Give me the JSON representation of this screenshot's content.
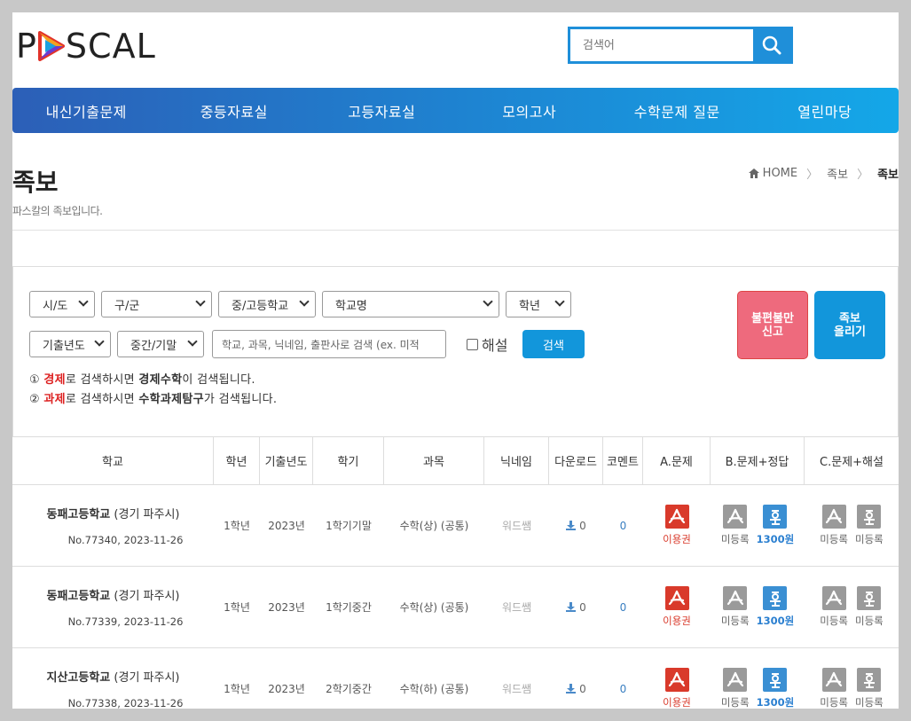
{
  "header": {
    "logo_left": "P",
    "logo_right": "SCAL",
    "search_placeholder": "검색어"
  },
  "nav": [
    "내신기출문제",
    "중등자료실",
    "고등자료실",
    "모의고사",
    "수학문제 질문",
    "열린마당"
  ],
  "page": {
    "title": "족보",
    "subtitle": "파스칼의 족보입니다.",
    "breadcrumb": {
      "home": "HOME",
      "parent": "족보",
      "current": "족보"
    }
  },
  "filters": {
    "row1": [
      "시/도",
      "구/군",
      "중/고등학교",
      "학교명",
      "학년"
    ],
    "row2": [
      "기출년도",
      "중간/기말"
    ],
    "keyword_placeholder": "학교, 과목, 닉네임, 출판사로 검색 (ex. 미적",
    "explain_label": "해설",
    "search_button": "검색",
    "report_button": [
      "불편불만",
      "신고"
    ],
    "upload_button": [
      "족보",
      "올리기"
    ],
    "note1": {
      "prefix": "① ",
      "hl": "경제",
      "mid": "로 검색하시면 ",
      "bold": "경제수학",
      "suffix": "이 검색됩니다."
    },
    "note2": {
      "prefix": "② ",
      "hl": "과제",
      "mid": "로 검색하시면 ",
      "bold": "수학과제탐구",
      "suffix": "가 검색됩니다."
    }
  },
  "table": {
    "headers": [
      "학교",
      "학년",
      "기출년도",
      "학기",
      "과목",
      "닉네임",
      "다운로드",
      "코멘트",
      "A.문제",
      "B.문제+정답",
      "C.문제+해설"
    ],
    "rows": [
      {
        "school": "동패고등학교",
        "region": "(경기 파주시)",
        "meta": "No.77340,    2023-11-26",
        "grade": "1학년",
        "year": "2023년",
        "term": "1학기기말",
        "subject": "수학(상) (공통)",
        "nick": "워드쌤",
        "downloads": "0",
        "comments": "0",
        "a_label": "이용권",
        "b1_label": "미등록",
        "b2_label": "1300원",
        "c1_label": "미등록",
        "c2_label": "미등록"
      },
      {
        "school": "동패고등학교",
        "region": "(경기 파주시)",
        "meta": "No.77339,    2023-11-26",
        "grade": "1학년",
        "year": "2023년",
        "term": "1학기중간",
        "subject": "수학(상) (공통)",
        "nick": "워드쌤",
        "downloads": "0",
        "comments": "0",
        "a_label": "이용권",
        "b1_label": "미등록",
        "b2_label": "1300원",
        "c1_label": "미등록",
        "c2_label": "미등록"
      },
      {
        "school": "지산고등학교",
        "region": "(경기 파주시)",
        "meta": "No.77338,    2023-11-26",
        "grade": "1학년",
        "year": "2023년",
        "term": "2학기중간",
        "subject": "수학(하) (공통)",
        "nick": "워드쌤",
        "downloads": "0",
        "comments": "0",
        "a_label": "이용권",
        "b1_label": "미등록",
        "b2_label": "1300원",
        "c1_label": "미등록",
        "c2_label": "미등록"
      }
    ]
  },
  "colors": {
    "brand_blue": "#1f8fd9",
    "accent_red": "#d93a2b",
    "report_pink": "#ee6a7d"
  }
}
